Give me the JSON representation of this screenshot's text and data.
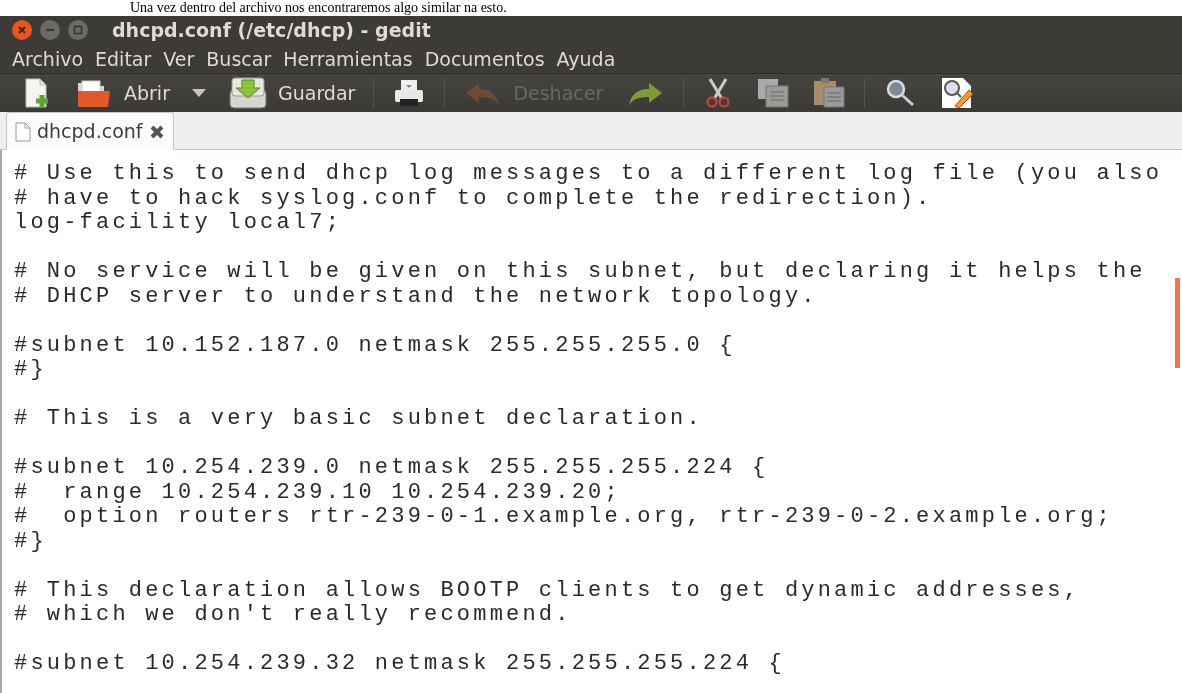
{
  "caption": "Una vez dentro del archivo nos encontraremos algo similar na esto.",
  "window": {
    "title": "dhcpd.conf (/etc/dhcp) - gedit"
  },
  "menu": [
    "Archivo",
    "Editar",
    "Ver",
    "Buscar",
    "Herramientas",
    "Documentos",
    "Ayuda"
  ],
  "toolbar": [
    {
      "kind": "button",
      "disabled": false
    },
    {
      "kind": "button",
      "label": "Abrir",
      "disabled": false
    },
    {
      "kind": "dropdown",
      "disabled": false
    },
    {
      "kind": "button",
      "label": "Guardar",
      "disabled": false
    },
    {
      "kind": "separator"
    },
    {
      "kind": "button",
      "disabled": false
    },
    {
      "kind": "separator"
    },
    {
      "kind": "button",
      "label": "Deshacer",
      "disabled": true
    },
    {
      "kind": "button",
      "disabled": false
    },
    {
      "kind": "separator"
    },
    {
      "kind": "button",
      "disabled": false
    },
    {
      "kind": "button",
      "disabled": false
    },
    {
      "kind": "button",
      "disabled": false
    },
    {
      "kind": "separator"
    },
    {
      "kind": "button",
      "disabled": false
    },
    {
      "kind": "button",
      "disabled": false
    }
  ],
  "tabs": [
    {
      "label": "dhcpd.conf",
      "selected": true
    }
  ],
  "editor": {
    "blocks": [
      [
        "# Use this to send dhcp log messages to a different log file (you also",
        "# have to hack syslog.conf to complete the redirection).",
        "log-facility local7;"
      ],
      [
        "# No service will be given on this subnet, but declaring it helps the",
        "# DHCP server to understand the network topology."
      ],
      [
        "#subnet 10.152.187.0 netmask 255.255.255.0 {",
        "#}"
      ],
      [
        "# This is a very basic subnet declaration."
      ],
      [
        "#subnet 10.254.239.0 netmask 255.255.255.224 {",
        "#  range 10.254.239.10 10.254.239.20;",
        "#  option routers rtr-239-0-1.example.org, rtr-239-0-2.example.org;",
        "#}"
      ],
      [
        "# This declaration allows BOOTP clients to get dynamic addresses,",
        "# which we don't really recommend."
      ],
      [
        "#subnet 10.254.239.32 netmask 255.255.255.224 {"
      ]
    ]
  }
}
